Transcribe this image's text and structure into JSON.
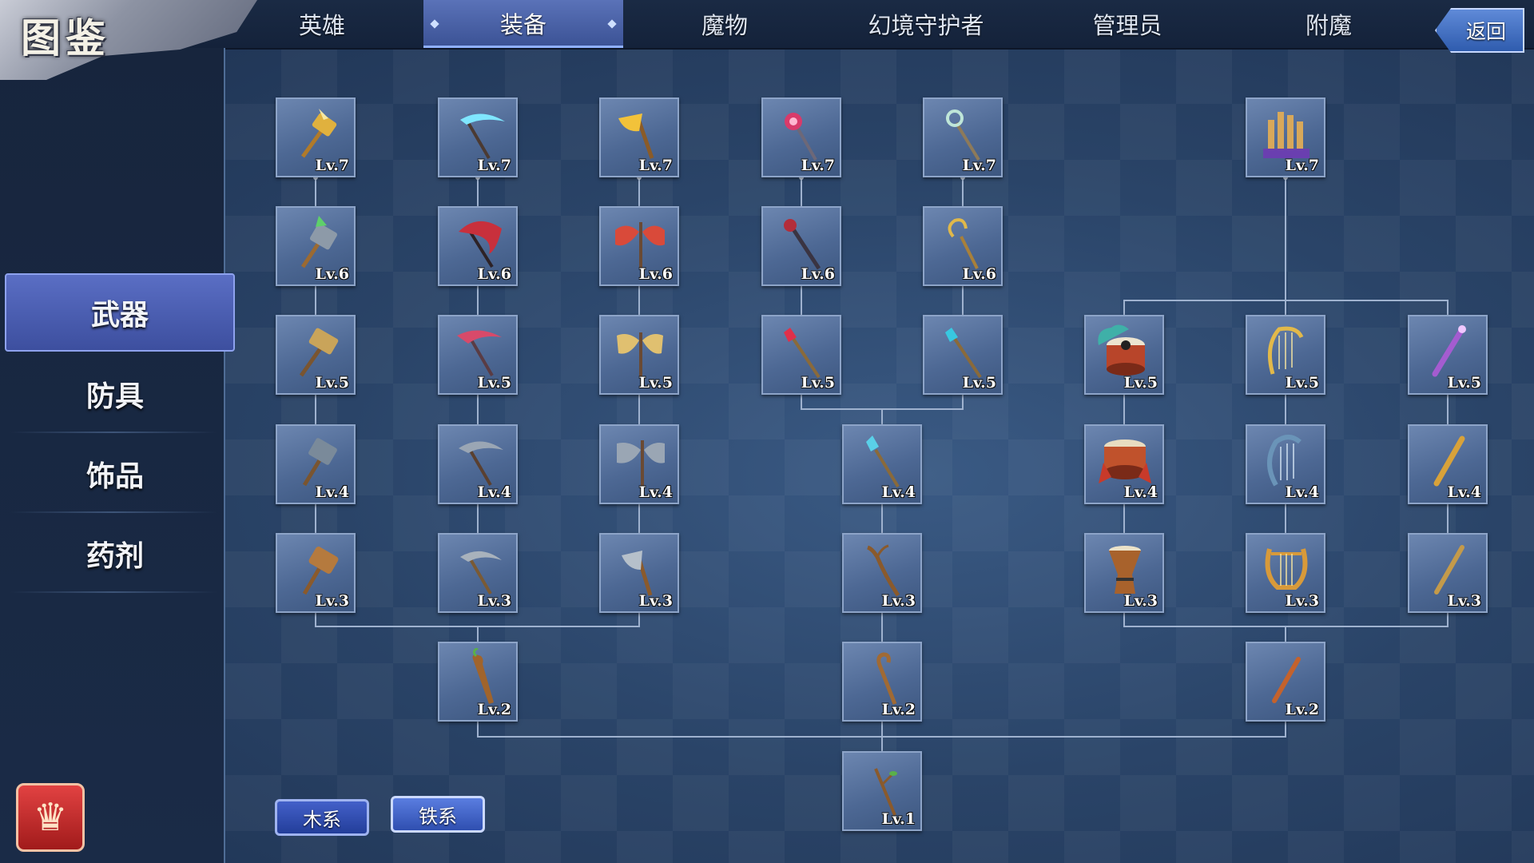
{
  "header": {
    "title": "图鉴",
    "tabs": [
      {
        "label": "英雄",
        "active": false
      },
      {
        "label": "装备",
        "active": true
      },
      {
        "label": "魔物",
        "active": false
      },
      {
        "label": "幻境守护者",
        "active": false
      },
      {
        "label": "管理员",
        "active": false
      },
      {
        "label": "附魔",
        "active": false
      }
    ],
    "back_label": "返回"
  },
  "sidebar": {
    "categories": [
      {
        "label": "武器",
        "active": true
      },
      {
        "label": "防具",
        "active": false
      },
      {
        "label": "饰品",
        "active": false
      },
      {
        "label": "药剂",
        "active": false
      }
    ],
    "trophy_icon": "trophy-icon"
  },
  "filters": {
    "wood_label": "木系",
    "iron_label": "铁系"
  },
  "colors": {
    "accent": "#4a63c0",
    "card_bg": "#5a74a0",
    "connector": "#9fb2cf"
  },
  "tree": {
    "items": [
      {
        "id": "hammer7",
        "level": "Lv.7",
        "icon": "golden-winged-hammer-icon"
      },
      {
        "id": "scythe7",
        "level": "Lv.7",
        "icon": "frost-scythe-icon"
      },
      {
        "id": "axe7",
        "level": "Lv.7",
        "icon": "golden-axe-icon"
      },
      {
        "id": "staffA7",
        "level": "Lv.7",
        "icon": "crimson-orb-staff-icon"
      },
      {
        "id": "staffB7",
        "level": "Lv.7",
        "icon": "serpent-staff-icon"
      },
      {
        "id": "organ7",
        "level": "Lv.7",
        "icon": "pipe-organ-icon"
      },
      {
        "id": "hammer6",
        "level": "Lv.6",
        "icon": "crystal-hammer-icon"
      },
      {
        "id": "scythe6",
        "level": "Lv.6",
        "icon": "crimson-scythe-icon"
      },
      {
        "id": "axe6",
        "level": "Lv.6",
        "icon": "dragon-axe-icon"
      },
      {
        "id": "staffA6",
        "level": "Lv.6",
        "icon": "dark-staff-icon"
      },
      {
        "id": "staffB6",
        "level": "Lv.6",
        "icon": "coiled-staff-icon"
      },
      {
        "id": "hammer5",
        "level": "Lv.5",
        "icon": "war-hammer-icon"
      },
      {
        "id": "scythe5",
        "level": "Lv.5",
        "icon": "red-scythe-icon"
      },
      {
        "id": "axe5",
        "level": "Lv.5",
        "icon": "winged-axe-icon"
      },
      {
        "id": "staffA5",
        "level": "Lv.5",
        "icon": "ruby-wand-icon"
      },
      {
        "id": "staffB5",
        "level": "Lv.5",
        "icon": "sapphire-wand-icon"
      },
      {
        "id": "drum5",
        "level": "Lv.5",
        "icon": "taiji-drum-icon"
      },
      {
        "id": "harp5",
        "level": "Lv.5",
        "icon": "golden-harp-icon"
      },
      {
        "id": "flute5",
        "level": "Lv.5",
        "icon": "violet-flute-icon"
      },
      {
        "id": "hammer4",
        "level": "Lv.4",
        "icon": "iron-hammer-icon"
      },
      {
        "id": "scythe4",
        "level": "Lv.4",
        "icon": "iron-scythe-icon"
      },
      {
        "id": "axe4",
        "level": "Lv.4",
        "icon": "battle-axe-icon"
      },
      {
        "id": "staff4",
        "level": "Lv.4",
        "icon": "crystal-staff-icon"
      },
      {
        "id": "drum4",
        "level": "Lv.4",
        "icon": "war-drum-icon"
      },
      {
        "id": "harp4",
        "level": "Lv.4",
        "icon": "dolphin-harp-icon"
      },
      {
        "id": "flute4",
        "level": "Lv.4",
        "icon": "golden-flute-icon"
      },
      {
        "id": "hammer3",
        "level": "Lv.3",
        "icon": "wooden-mallet-icon"
      },
      {
        "id": "scythe3",
        "level": "Lv.3",
        "icon": "sickle-icon"
      },
      {
        "id": "axe3",
        "level": "Lv.3",
        "icon": "hatchet-icon"
      },
      {
        "id": "staff3",
        "level": "Lv.3",
        "icon": "gnarled-staff-icon"
      },
      {
        "id": "drum3",
        "level": "Lv.3",
        "icon": "djembe-icon"
      },
      {
        "id": "harp3",
        "level": "Lv.3",
        "icon": "lyre-icon"
      },
      {
        "id": "flute3",
        "level": "Lv.3",
        "icon": "bamboo-flute-icon"
      },
      {
        "id": "club2",
        "level": "Lv.2",
        "icon": "wooden-club-icon"
      },
      {
        "id": "cane2",
        "level": "Lv.2",
        "icon": "wooden-cane-icon"
      },
      {
        "id": "pipe2",
        "level": "Lv.2",
        "icon": "reed-pipe-icon"
      },
      {
        "id": "branch1",
        "level": "Lv.1",
        "icon": "branch-icon"
      }
    ]
  }
}
